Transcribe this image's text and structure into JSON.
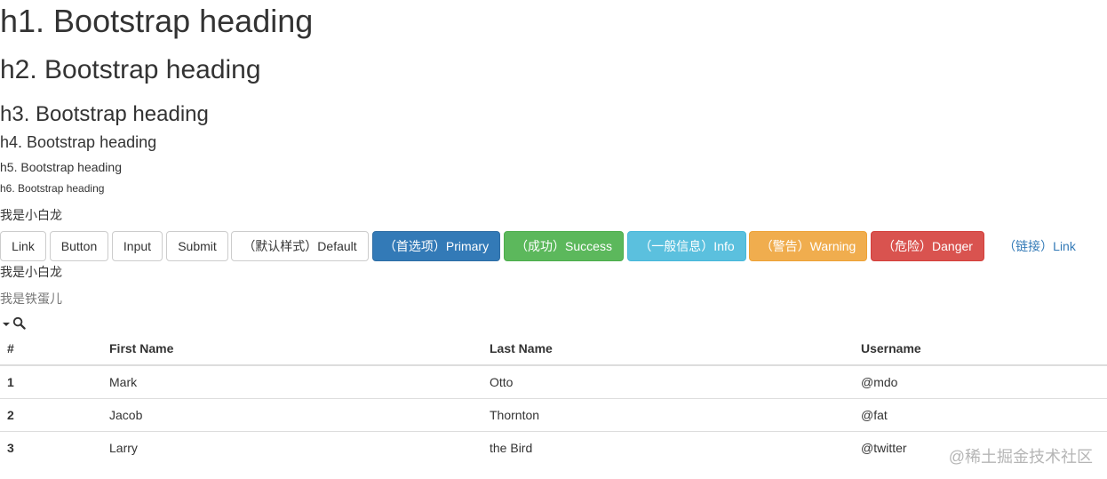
{
  "headings": {
    "h1": "h1. Bootstrap heading",
    "h2": "h2. Bootstrap heading",
    "h3": "h3. Bootstrap heading",
    "h4": "h4. Bootstrap heading",
    "h5": "h5. Bootstrap heading",
    "h6": "h6. Bootstrap heading"
  },
  "paragraphs": {
    "intro": "我是小白龙",
    "second": "我是小白龙",
    "muted": "我是铁蛋儿"
  },
  "buttons": {
    "link": "Link",
    "button": "Button",
    "input": "Input",
    "submit": "Submit",
    "default": "（默认样式）Default",
    "primary": "（首选项）Primary",
    "success": "（成功）Success",
    "info": "（一般信息）Info",
    "warning": "（警告）Warning",
    "danger": "（危险）Danger",
    "link_btn": "（链接）Link"
  },
  "icons": [
    "caret-down-icon",
    "search-icon"
  ],
  "table": {
    "headers": [
      "#",
      "First Name",
      "Last Name",
      "Username"
    ],
    "rows": [
      [
        "1",
        "Mark",
        "Otto",
        "@mdo"
      ],
      [
        "2",
        "Jacob",
        "Thornton",
        "@fat"
      ],
      [
        "3",
        "Larry",
        "the Bird",
        "@twitter"
      ]
    ]
  },
  "watermark": "@稀土掘金技术社区",
  "colors": {
    "primary": "#337ab7",
    "success": "#5cb85c",
    "info": "#5bc0de",
    "warning": "#f0ad4e",
    "danger": "#d9534f",
    "text": "#333333",
    "muted": "#777777"
  }
}
